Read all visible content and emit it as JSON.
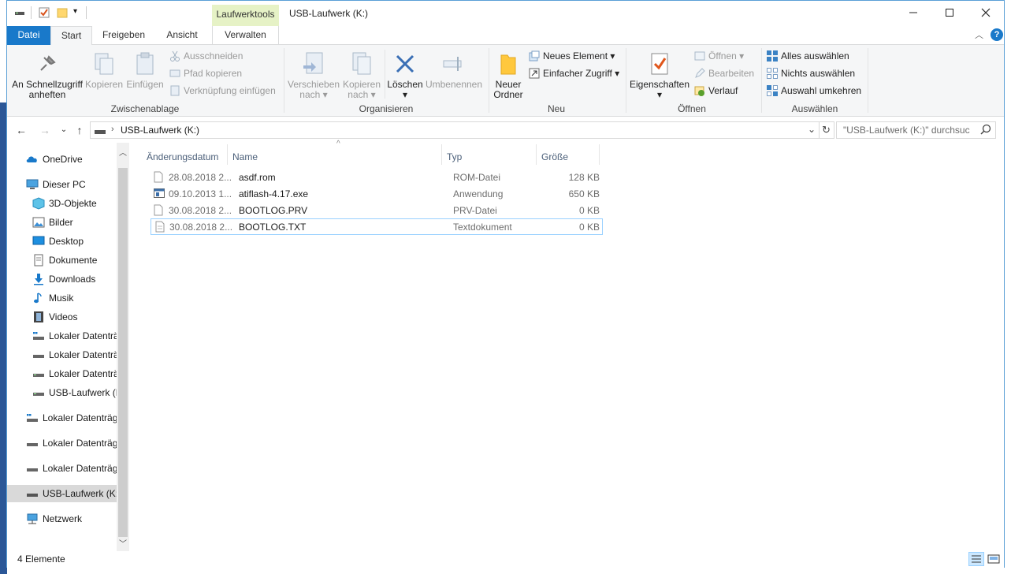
{
  "window": {
    "title": "USB-Laufwerk (K:)",
    "context_tab_group": "Laufwerktools"
  },
  "tabs": [
    {
      "label": "Datei"
    },
    {
      "label": "Start"
    },
    {
      "label": "Freigeben"
    },
    {
      "label": "Ansicht"
    },
    {
      "label": "Verwalten"
    }
  ],
  "ribbon": {
    "clipboard": {
      "label": "Zwischenablage",
      "pin_label_1": "An Schnellzugriff",
      "pin_label_2": "anheften",
      "copy_label": "Kopieren",
      "paste_label": "Einfügen",
      "cut_label": "Ausschneiden",
      "copy_path_label": "Pfad kopieren",
      "paste_shortcut_label": "Verknüpfung einfügen"
    },
    "organize": {
      "label": "Organisieren",
      "move_1": "Verschieben",
      "move_2": "nach",
      "copy_1": "Kopieren",
      "copy_2": "nach",
      "delete_label": "Löschen",
      "rename_label": "Umbenennen"
    },
    "new": {
      "label": "Neu",
      "new_folder_1": "Neuer",
      "new_folder_2": "Ordner",
      "new_item_label": "Neues Element",
      "easy_access_label": "Einfacher Zugriff"
    },
    "open": {
      "label": "Öffnen",
      "properties_label": "Eigenschaften",
      "open_label": "Öffnen",
      "edit_label": "Bearbeiten",
      "history_label": "Verlauf"
    },
    "select": {
      "label": "Auswählen",
      "select_all_label": "Alles auswählen",
      "select_none_label": "Nichts auswählen",
      "invert_label": "Auswahl umkehren"
    }
  },
  "address": {
    "path": "USB-Laufwerk (K:)",
    "search_placeholder": "\"USB-Laufwerk (K:)\" durchsuc"
  },
  "nav": {
    "onedrive": "OneDrive",
    "this_pc": "Dieser PC",
    "objects3d": "3D-Objekte",
    "pictures": "Bilder",
    "desktop": "Desktop",
    "documents": "Dokumente",
    "downloads": "Downloads",
    "music": "Musik",
    "videos": "Videos",
    "local1": "Lokaler Datenträ",
    "local2": "Lokaler Datenträ",
    "local3": "Lokaler Datenträ",
    "usb_sub": "USB-Laufwerk (K",
    "local4": "Lokaler Datenträg",
    "local5": "Lokaler Datenträg",
    "local6": "Lokaler Datenträg",
    "usb": "USB-Laufwerk (K:)",
    "network": "Netzwerk"
  },
  "columns": {
    "date": "Änderungsdatum",
    "name": "Name",
    "type": "Typ",
    "size": "Größe"
  },
  "files": [
    {
      "date": "28.08.2018 2...",
      "name": "asdf.rom",
      "type": "ROM-Datei",
      "size": "128 KB"
    },
    {
      "date": "09.10.2013 1...",
      "name": "atiflash-4.17.exe",
      "type": "Anwendung",
      "size": "650 KB"
    },
    {
      "date": "30.08.2018 2...",
      "name": "BOOTLOG.PRV",
      "type": "PRV-Datei",
      "size": "0 KB"
    },
    {
      "date": "30.08.2018 2...",
      "name": "BOOTLOG.TXT",
      "type": "Textdokument",
      "size": "0 KB"
    }
  ],
  "status": {
    "count": "4 Elemente"
  },
  "colors": {
    "accent": "#1979ca",
    "context_tab": "#e6f2c6",
    "selection_border": "#99d1ff"
  }
}
